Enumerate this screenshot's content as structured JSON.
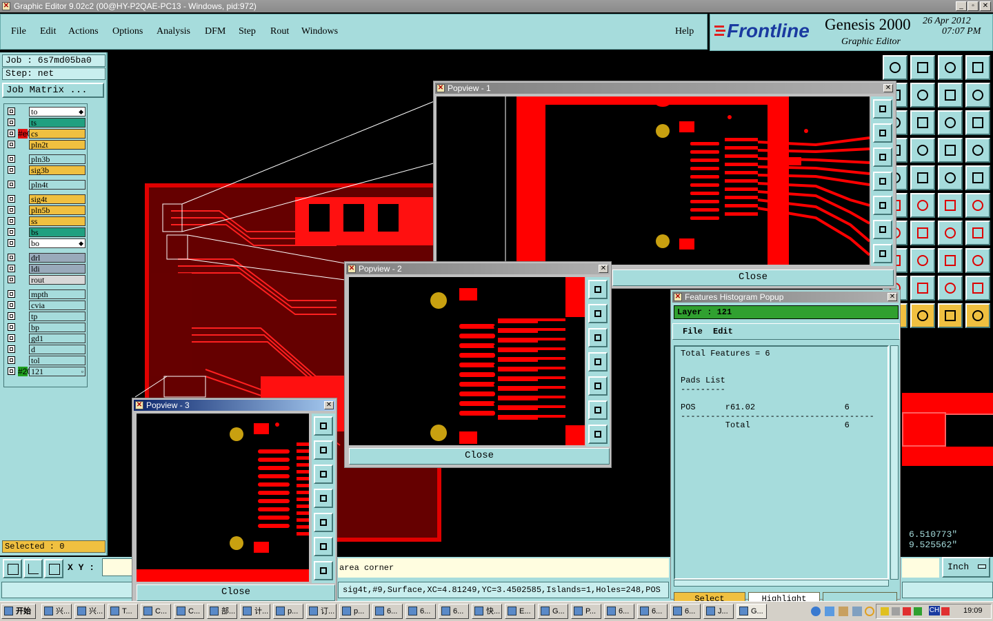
{
  "titlebar": {
    "title": "Graphic Editor 9.02c2 (00@HY-P2QAE-PC13 - Windows, pid:972)",
    "min": "_",
    "max": "▫",
    "close": "✕"
  },
  "menu": [
    "File",
    "Edit",
    "Actions",
    "Options",
    "Analysis",
    "DFM",
    "Step",
    "Rout",
    "Windows"
  ],
  "help": "Help",
  "brand": {
    "logo": "Frontline",
    "product": "Genesis 2000",
    "subtitle": "Graphic Editor",
    "date": "26 Apr 2012",
    "time": "07:07 PM"
  },
  "job": {
    "job_label": "Job : 6s7md05ba0",
    "step_label": "Step: net",
    "matrix_button": "Job Matrix ..."
  },
  "layers": [
    {
      "name": "to",
      "color": "#ffffff",
      "swatch": "",
      "mark": "◆"
    },
    {
      "name": "ts",
      "color": "#20a080",
      "swatch": ""
    },
    {
      "name": "cs",
      "color": "#f0c040",
      "swatch": "#e01010"
    },
    {
      "name": "pln2t",
      "color": "#f0c040",
      "swatch": ""
    },
    {
      "name": "pln3b",
      "color": "#a6dcdc",
      "swatch": ""
    },
    {
      "name": "sig3b",
      "color": "#f0c040",
      "swatch": ""
    },
    {
      "name": "pln4t",
      "color": "#a6dcdc",
      "swatch": ""
    },
    {
      "name": "sig4t",
      "color": "#f0c040",
      "swatch": ""
    },
    {
      "name": "pln5b",
      "color": "#f0c040",
      "swatch": ""
    },
    {
      "name": "ss",
      "color": "#f0c040",
      "swatch": ""
    },
    {
      "name": "bs",
      "color": "#20a080",
      "swatch": ""
    },
    {
      "name": "bo",
      "color": "#ffffff",
      "swatch": "",
      "mark": "◆"
    },
    {
      "name": "drl",
      "color": "#9ab",
      "swatch": ""
    },
    {
      "name": "ldi",
      "color": "#9ab",
      "swatch": ""
    },
    {
      "name": "rout",
      "color": "#d8d8d8",
      "swatch": ""
    },
    {
      "name": "mpth",
      "color": "#a6dcdc",
      "swatch": ""
    },
    {
      "name": "cvia",
      "color": "#a6dcdc",
      "swatch": ""
    },
    {
      "name": "tp",
      "color": "#a6dcdc",
      "swatch": ""
    },
    {
      "name": "bp",
      "color": "#a6dcdc",
      "swatch": ""
    },
    {
      "name": "gd1",
      "color": "#a6dcdc",
      "swatch": ""
    },
    {
      "name": "d",
      "color": "#a6dcdc",
      "swatch": ""
    },
    {
      "name": "tol",
      "color": "#a6dcdc",
      "swatch": ""
    },
    {
      "name": "121",
      "color": "#a6dcdc",
      "swatch": "#20a020",
      "mark": "▫"
    }
  ],
  "selected": "Selected : 0",
  "xy_label": "X Y :",
  "coords": {
    "x": "6.510773\"",
    "y": "9.525562\""
  },
  "units": "Inch",
  "status": {
    "prompt": "area corner",
    "info": "sig4t,#9,Surface,XC=4.81249,YC=3.4502585,Islands=1,Holes=248,POS"
  },
  "popviews": [
    {
      "title": "Popview - 1",
      "close": "Close"
    },
    {
      "title": "Popview - 2",
      "close": "Close"
    },
    {
      "title": "Popview - 3",
      "close": "Close"
    }
  ],
  "histogram": {
    "title": "Features Histogram Popup",
    "layer": "Layer :  121",
    "menu": [
      "File",
      "Edit"
    ],
    "body": "Total Features = 6\n\n\nPads List\n---------\n\nPOS      r61.02                  6\n---------------------------------------\n         Total                   6",
    "buttons": [
      "Select",
      "Highlight",
      ""
    ]
  },
  "taskbar": {
    "start": "开始",
    "tasks": [
      "兴...",
      "兴...",
      "T...",
      "C...",
      "C...",
      "部...",
      "计...",
      "p...",
      "订...",
      "p...",
      "6...",
      "6...",
      "6...",
      "快...",
      "E...",
      "G...",
      "P...",
      "6...",
      "6...",
      "6...",
      "J...",
      "G..."
    ],
    "lang": "CH",
    "clock": "19:09"
  },
  "colors": {
    "panel": "#a6dcdc",
    "copper": "#ff0000",
    "pad": "#c8a010"
  }
}
